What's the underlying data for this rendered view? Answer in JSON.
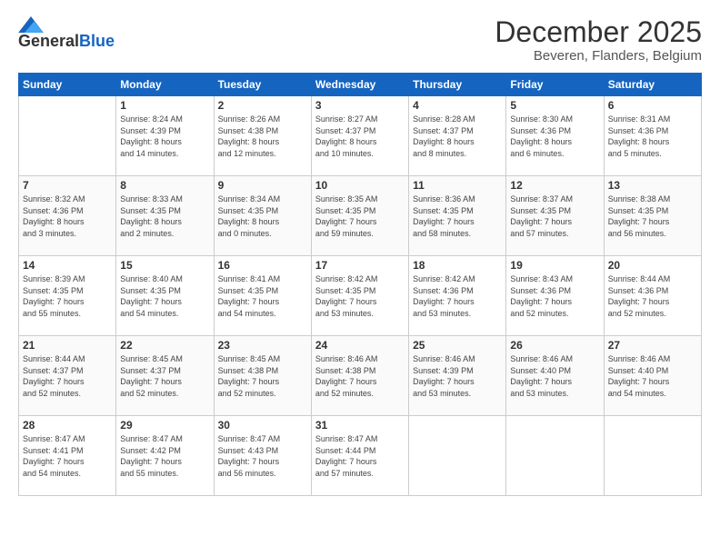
{
  "header": {
    "logo_general": "General",
    "logo_blue": "Blue",
    "title": "December 2025",
    "subtitle": "Beveren, Flanders, Belgium"
  },
  "weekdays": [
    "Sunday",
    "Monday",
    "Tuesday",
    "Wednesday",
    "Thursday",
    "Friday",
    "Saturday"
  ],
  "weeks": [
    [
      {
        "day": "",
        "info": ""
      },
      {
        "day": "1",
        "info": "Sunrise: 8:24 AM\nSunset: 4:39 PM\nDaylight: 8 hours\nand 14 minutes."
      },
      {
        "day": "2",
        "info": "Sunrise: 8:26 AM\nSunset: 4:38 PM\nDaylight: 8 hours\nand 12 minutes."
      },
      {
        "day": "3",
        "info": "Sunrise: 8:27 AM\nSunset: 4:37 PM\nDaylight: 8 hours\nand 10 minutes."
      },
      {
        "day": "4",
        "info": "Sunrise: 8:28 AM\nSunset: 4:37 PM\nDaylight: 8 hours\nand 8 minutes."
      },
      {
        "day": "5",
        "info": "Sunrise: 8:30 AM\nSunset: 4:36 PM\nDaylight: 8 hours\nand 6 minutes."
      },
      {
        "day": "6",
        "info": "Sunrise: 8:31 AM\nSunset: 4:36 PM\nDaylight: 8 hours\nand 5 minutes."
      }
    ],
    [
      {
        "day": "7",
        "info": "Sunrise: 8:32 AM\nSunset: 4:36 PM\nDaylight: 8 hours\nand 3 minutes."
      },
      {
        "day": "8",
        "info": "Sunrise: 8:33 AM\nSunset: 4:35 PM\nDaylight: 8 hours\nand 2 minutes."
      },
      {
        "day": "9",
        "info": "Sunrise: 8:34 AM\nSunset: 4:35 PM\nDaylight: 8 hours\nand 0 minutes."
      },
      {
        "day": "10",
        "info": "Sunrise: 8:35 AM\nSunset: 4:35 PM\nDaylight: 7 hours\nand 59 minutes."
      },
      {
        "day": "11",
        "info": "Sunrise: 8:36 AM\nSunset: 4:35 PM\nDaylight: 7 hours\nand 58 minutes."
      },
      {
        "day": "12",
        "info": "Sunrise: 8:37 AM\nSunset: 4:35 PM\nDaylight: 7 hours\nand 57 minutes."
      },
      {
        "day": "13",
        "info": "Sunrise: 8:38 AM\nSunset: 4:35 PM\nDaylight: 7 hours\nand 56 minutes."
      }
    ],
    [
      {
        "day": "14",
        "info": "Sunrise: 8:39 AM\nSunset: 4:35 PM\nDaylight: 7 hours\nand 55 minutes."
      },
      {
        "day": "15",
        "info": "Sunrise: 8:40 AM\nSunset: 4:35 PM\nDaylight: 7 hours\nand 54 minutes."
      },
      {
        "day": "16",
        "info": "Sunrise: 8:41 AM\nSunset: 4:35 PM\nDaylight: 7 hours\nand 54 minutes."
      },
      {
        "day": "17",
        "info": "Sunrise: 8:42 AM\nSunset: 4:35 PM\nDaylight: 7 hours\nand 53 minutes."
      },
      {
        "day": "18",
        "info": "Sunrise: 8:42 AM\nSunset: 4:36 PM\nDaylight: 7 hours\nand 53 minutes."
      },
      {
        "day": "19",
        "info": "Sunrise: 8:43 AM\nSunset: 4:36 PM\nDaylight: 7 hours\nand 52 minutes."
      },
      {
        "day": "20",
        "info": "Sunrise: 8:44 AM\nSunset: 4:36 PM\nDaylight: 7 hours\nand 52 minutes."
      }
    ],
    [
      {
        "day": "21",
        "info": "Sunrise: 8:44 AM\nSunset: 4:37 PM\nDaylight: 7 hours\nand 52 minutes."
      },
      {
        "day": "22",
        "info": "Sunrise: 8:45 AM\nSunset: 4:37 PM\nDaylight: 7 hours\nand 52 minutes."
      },
      {
        "day": "23",
        "info": "Sunrise: 8:45 AM\nSunset: 4:38 PM\nDaylight: 7 hours\nand 52 minutes."
      },
      {
        "day": "24",
        "info": "Sunrise: 8:46 AM\nSunset: 4:38 PM\nDaylight: 7 hours\nand 52 minutes."
      },
      {
        "day": "25",
        "info": "Sunrise: 8:46 AM\nSunset: 4:39 PM\nDaylight: 7 hours\nand 53 minutes."
      },
      {
        "day": "26",
        "info": "Sunrise: 8:46 AM\nSunset: 4:40 PM\nDaylight: 7 hours\nand 53 minutes."
      },
      {
        "day": "27",
        "info": "Sunrise: 8:46 AM\nSunset: 4:40 PM\nDaylight: 7 hours\nand 54 minutes."
      }
    ],
    [
      {
        "day": "28",
        "info": "Sunrise: 8:47 AM\nSunset: 4:41 PM\nDaylight: 7 hours\nand 54 minutes."
      },
      {
        "day": "29",
        "info": "Sunrise: 8:47 AM\nSunset: 4:42 PM\nDaylight: 7 hours\nand 55 minutes."
      },
      {
        "day": "30",
        "info": "Sunrise: 8:47 AM\nSunset: 4:43 PM\nDaylight: 7 hours\nand 56 minutes."
      },
      {
        "day": "31",
        "info": "Sunrise: 8:47 AM\nSunset: 4:44 PM\nDaylight: 7 hours\nand 57 minutes."
      },
      {
        "day": "",
        "info": ""
      },
      {
        "day": "",
        "info": ""
      },
      {
        "day": "",
        "info": ""
      }
    ]
  ]
}
